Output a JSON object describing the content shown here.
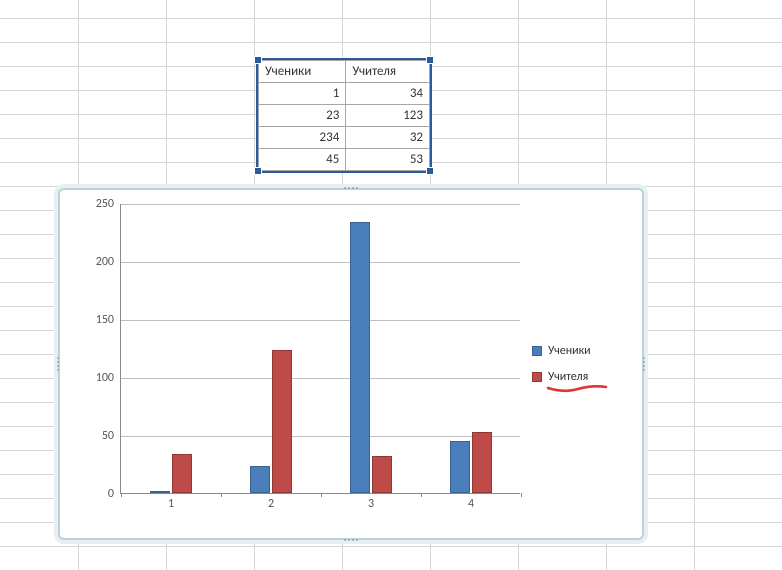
{
  "table": {
    "headers": [
      "Ученики",
      "Учителя"
    ],
    "rows": [
      [
        1,
        34
      ],
      [
        23,
        123
      ],
      [
        234,
        32
      ],
      [
        45,
        53
      ]
    ]
  },
  "chart_data": {
    "type": "bar",
    "categories": [
      "1",
      "2",
      "3",
      "4"
    ],
    "series": [
      {
        "name": "Ученики",
        "color": "#4a7ebb",
        "values": [
          1,
          23,
          234,
          45
        ]
      },
      {
        "name": "Учителя",
        "color": "#be4b48",
        "values": [
          34,
          123,
          32,
          53
        ]
      }
    ],
    "ylim": [
      0,
      250
    ],
    "ytick_step": 50,
    "grid": true,
    "legend_position": "right",
    "title": "",
    "xlabel": "",
    "ylabel": ""
  },
  "annotation": {
    "legend_item_underlined": "Учителя",
    "underline_color": "#e3342f"
  }
}
